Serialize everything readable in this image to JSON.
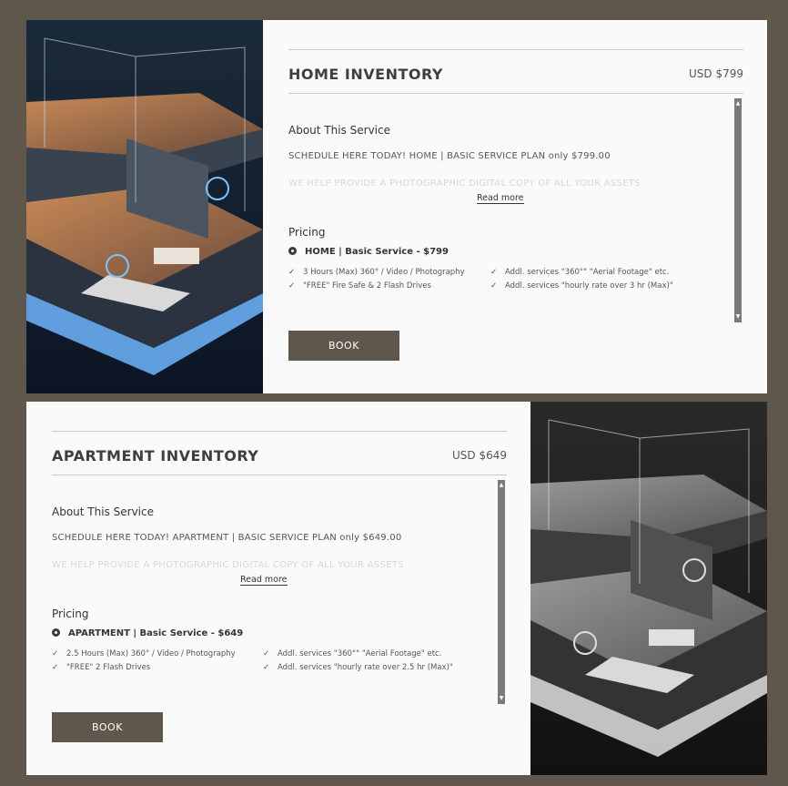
{
  "colors": {
    "frame": "#5f564c",
    "card": "#fafafa",
    "button": "#5f564c"
  },
  "cards": [
    {
      "title": "HOME INVENTORY",
      "price": "USD $799",
      "about_heading": "About This Service",
      "description": "SCHEDULE HERE TODAY! HOME | BASIC SERVICE PLAN only $799.00",
      "description_more": "WE HELP PROVIDE A PHOTOGRAPHIC DIGITAL COPY OF ALL YOUR ASSETS",
      "read_more": "Read more",
      "pricing_heading": "Pricing",
      "option": "HOME | Basic Service - $799",
      "features": [
        "3 Hours (Max) 360° / Video / Photography",
        "\"FREE\" Fire Safe & 2 Flash Drives",
        "Addl. services \"360°\" \"Aerial Footage\" etc.",
        "Addl. services \"hourly rate over 3 hr (Max)\""
      ],
      "book": "BOOK",
      "image": "isometric-smart-home-color"
    },
    {
      "title": "APARTMENT INVENTORY",
      "price": "USD $649",
      "about_heading": "About This Service",
      "description": "SCHEDULE HERE TODAY! APARTMENT | BASIC SERVICE PLAN only $649.00",
      "description_more": "WE HELP PROVIDE A PHOTOGRAPHIC DIGITAL COPY OF ALL YOUR ASSETS",
      "read_more": "Read more",
      "pricing_heading": "Pricing",
      "option": "APARTMENT | Basic Service - $649",
      "features": [
        "2.5 Hours (Max) 360° / Video / Photography",
        "\"FREE\" 2 Flash Drives",
        "Addl. services \"360°\" \"Aerial Footage\" etc.",
        "Addl. services \"hourly rate over 2.5 hr (Max)\""
      ],
      "book": "BOOK",
      "image": "isometric-smart-home-grayscale"
    }
  ]
}
